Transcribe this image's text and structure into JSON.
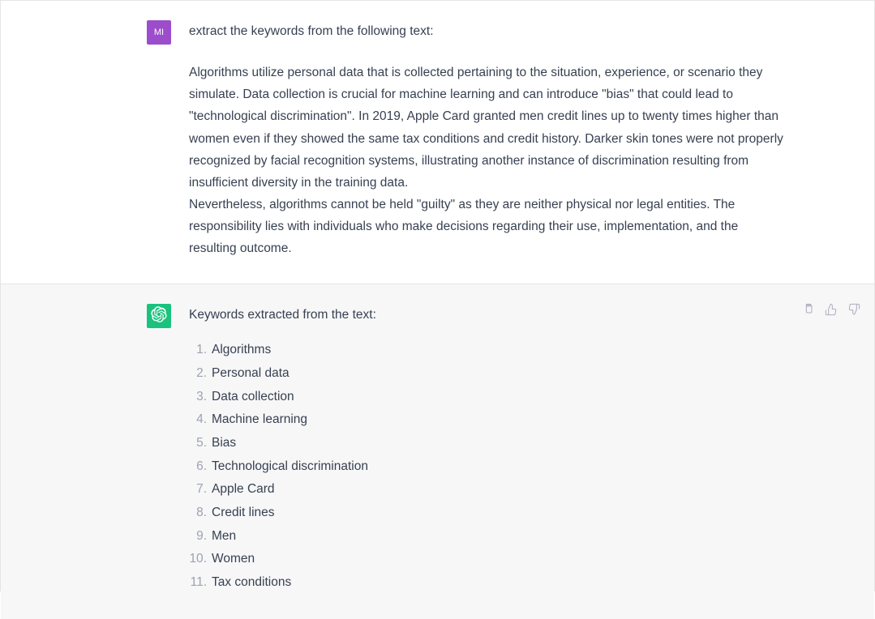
{
  "user": {
    "avatar_initials": "MI",
    "prompt": "extract the keywords from the following text:",
    "text": "Algorithms utilize personal data that is collected pertaining to the situation, experience, or scenario they simulate. Data collection is crucial for machine learning and can introduce \"bias\" that could lead to \"technological discrimination\". In 2019, Apple Card granted men credit lines up to twenty times higher than women even if they showed the same tax conditions and credit history. Darker skin tones were not properly recognized by facial recognition systems, illustrating another instance of discrimination resulting from insufficient diversity in the training data.\nNevertheless, algorithms cannot be held \"guilty\" as they are neither physical nor legal entities. The responsibility lies with individuals who make decisions regarding their use, implementation, and the resulting outcome."
  },
  "assistant": {
    "intro": "Keywords extracted from the text:",
    "keywords": [
      "Algorithms",
      "Personal data",
      "Data collection",
      "Machine learning",
      "Bias",
      "Technological discrimination",
      "Apple Card",
      "Credit lines",
      "Men",
      "Women",
      "Tax conditions"
    ]
  }
}
